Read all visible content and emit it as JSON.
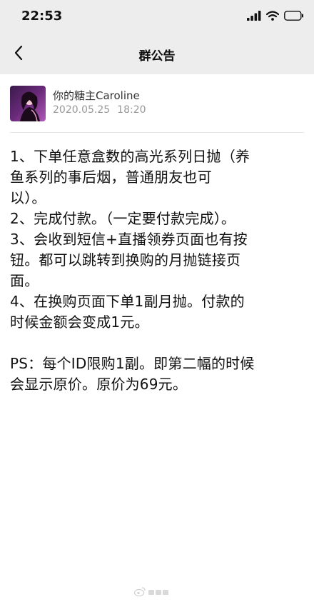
{
  "status_bar": {
    "time": "22:53",
    "signal_icon": "signal-bars-icon",
    "wifi_icon": "wifi-icon",
    "battery_icon": "battery-icon"
  },
  "nav": {
    "back_icon": "chevron-left-icon",
    "title": "群公告"
  },
  "author": {
    "name": "你的糖主Caroline",
    "date": "2020.05.25",
    "time": "18:20"
  },
  "announcement": {
    "lines": [
      "1、下单任意盒数的高光系列日抛（养",
      "鱼系列的事后烟，普通朋友也可",
      "以）。",
      "2、完成付款。（一定要付款完成）。",
      "3、会收到短信+直播领券页面也有按",
      "钮。都可以跳转到换购的月抛链接页",
      "面。",
      "4、在换购页面下单1副月抛。付款的",
      "时候金额会变成1元。"
    ],
    "ps_lines": [
      "PS：每个ID限购1副。即第二幅的时候",
      "会显示原价。原价为69元。"
    ]
  },
  "watermark": {
    "icon": "weibo-logo-icon"
  },
  "colors": {
    "bar_background": "#ededed",
    "text": "#111111",
    "muted": "#999999"
  }
}
